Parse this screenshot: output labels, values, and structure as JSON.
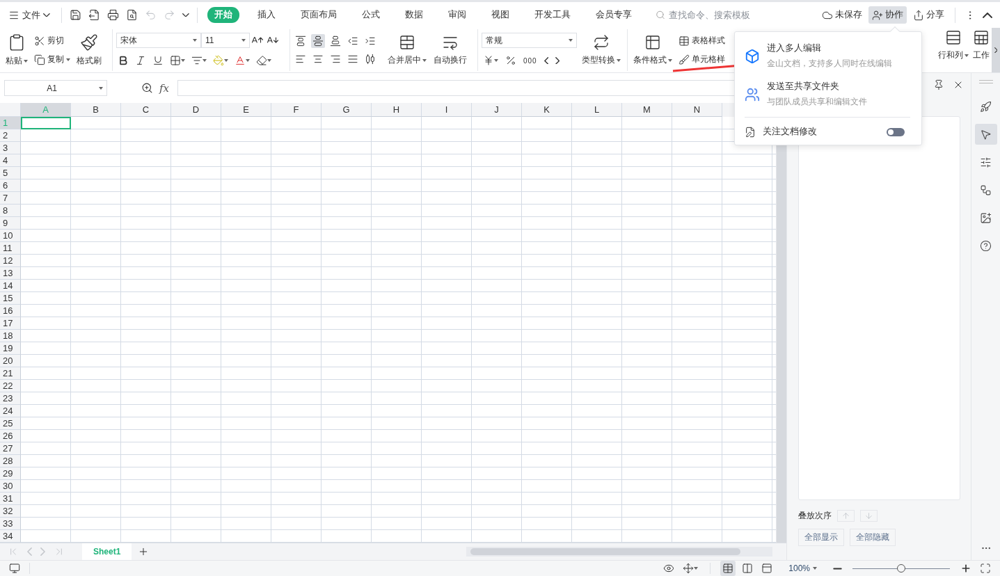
{
  "menu": {
    "label": "文件"
  },
  "quick_access": [
    {
      "kind": "save",
      "disabled": false
    },
    {
      "kind": "export",
      "disabled": false
    },
    {
      "kind": "print",
      "disabled": false
    },
    {
      "kind": "preview",
      "disabled": false
    },
    {
      "kind": "undo",
      "disabled": true
    },
    {
      "kind": "redo",
      "disabled": true
    },
    {
      "kind": "customize",
      "disabled": false
    }
  ],
  "tabs": [
    {
      "label": "开始",
      "selected": true
    },
    {
      "label": "插入",
      "selected": false
    },
    {
      "label": "页面布局",
      "selected": false
    },
    {
      "label": "公式",
      "selected": false
    },
    {
      "label": "数据",
      "selected": false
    },
    {
      "label": "审阅",
      "selected": false
    },
    {
      "label": "视图",
      "selected": false
    },
    {
      "label": "开发工具",
      "selected": false
    },
    {
      "label": "会员专享",
      "selected": false
    }
  ],
  "search": {
    "placeholder": "查找命令、搜索模板"
  },
  "header_actions": [
    {
      "kind": "unsaved",
      "label": "未保存",
      "selected": false
    },
    {
      "kind": "collab",
      "label": "协作",
      "selected": true
    },
    {
      "kind": "share",
      "label": "分享",
      "selected": false
    }
  ],
  "ribbon": {
    "clipboard": {
      "paste": "粘贴",
      "cut": "剪切",
      "copy": "复制",
      "format_painter": "格式刷"
    },
    "font": {
      "name": "宋体",
      "size": "11"
    },
    "align_buttons": [
      {
        "kind": "top",
        "selected": false
      },
      {
        "kind": "middle",
        "selected": true
      },
      {
        "kind": "bottom",
        "selected": false
      },
      {
        "kind": "outdent",
        "selected": false
      },
      {
        "kind": "indent",
        "selected": false
      },
      {
        "kind": "left",
        "selected": false
      },
      {
        "kind": "center",
        "selected": false
      },
      {
        "kind": "right",
        "selected": false
      },
      {
        "kind": "justify",
        "selected": false
      },
      {
        "kind": "distribute",
        "selected": false
      }
    ],
    "merge": "合并居中",
    "wrap": "自动换行",
    "number": {
      "format": "常规",
      "thousands": "000",
      "convert": "类型转换"
    },
    "styles": {
      "conditional": "条件格式",
      "table_style": "表格样式",
      "cell_style": "单元格样"
    },
    "rows_cols": "行和列",
    "worksheet": "工作"
  },
  "popup": {
    "items": [
      {
        "kind": "cloud_doc",
        "title": "进入多人编辑",
        "subtitle": "金山文档，支持多人同时在线编辑"
      },
      {
        "kind": "shared_folder",
        "title": "发送至共享文件夹",
        "subtitle": "与团队成员共享和编辑文件"
      }
    ],
    "toggle": {
      "label": "关注文档修改",
      "on": false
    }
  },
  "formula_bar": {
    "name_box": "A1",
    "fx": "fx"
  },
  "grid": {
    "columns": [
      {
        "label": "A",
        "selected": true
      },
      {
        "label": "B",
        "selected": false
      },
      {
        "label": "C",
        "selected": false
      },
      {
        "label": "D",
        "selected": false
      },
      {
        "label": "E",
        "selected": false
      },
      {
        "label": "F",
        "selected": false
      },
      {
        "label": "G",
        "selected": false
      },
      {
        "label": "H",
        "selected": false
      },
      {
        "label": "I",
        "selected": false
      },
      {
        "label": "J",
        "selected": false
      },
      {
        "label": "K",
        "selected": false
      },
      {
        "label": "L",
        "selected": false
      },
      {
        "label": "M",
        "selected": false
      },
      {
        "label": "N",
        "selected": false
      }
    ],
    "rows": [
      {
        "label": "1",
        "selected": true
      },
      {
        "label": "2",
        "selected": false
      },
      {
        "label": "3",
        "selected": false
      },
      {
        "label": "4",
        "selected": false
      },
      {
        "label": "5",
        "selected": false
      },
      {
        "label": "6",
        "selected": false
      },
      {
        "label": "7",
        "selected": false
      },
      {
        "label": "8",
        "selected": false
      },
      {
        "label": "9",
        "selected": false
      },
      {
        "label": "10",
        "selected": false
      },
      {
        "label": "11",
        "selected": false
      },
      {
        "label": "12",
        "selected": false
      },
      {
        "label": "13",
        "selected": false
      },
      {
        "label": "14",
        "selected": false
      },
      {
        "label": "15",
        "selected": false
      },
      {
        "label": "16",
        "selected": false
      },
      {
        "label": "17",
        "selected": false
      },
      {
        "label": "18",
        "selected": false
      },
      {
        "label": "19",
        "selected": false
      },
      {
        "label": "20",
        "selected": false
      },
      {
        "label": "21",
        "selected": false
      },
      {
        "label": "22",
        "selected": false
      },
      {
        "label": "23",
        "selected": false
      },
      {
        "label": "24",
        "selected": false
      },
      {
        "label": "25",
        "selected": false
      },
      {
        "label": "26",
        "selected": false
      },
      {
        "label": "27",
        "selected": false
      },
      {
        "label": "28",
        "selected": false
      },
      {
        "label": "29",
        "selected": false
      },
      {
        "label": "30",
        "selected": false
      },
      {
        "label": "31",
        "selected": false
      },
      {
        "label": "32",
        "selected": false
      },
      {
        "label": "33",
        "selected": false
      },
      {
        "label": "34",
        "selected": false
      }
    ]
  },
  "sheets": [
    {
      "label": "Sheet1",
      "selected": true
    }
  ],
  "side_panel": {
    "order_label": "叠放次序",
    "buttons": [
      "全部显示",
      "全部隐藏"
    ]
  },
  "side_tools": [
    {
      "kind": "rocket",
      "selected": false
    },
    {
      "kind": "pointer",
      "selected": true
    },
    {
      "kind": "sliders",
      "selected": false
    },
    {
      "kind": "flow",
      "selected": false
    },
    {
      "kind": "image",
      "selected": false
    },
    {
      "kind": "help",
      "selected": false
    }
  ],
  "status_bar": {
    "view_modes": [
      {
        "kind": "normal",
        "selected": true
      },
      {
        "kind": "page_break",
        "selected": false
      },
      {
        "kind": "reading",
        "selected": false
      }
    ],
    "zoom": "100%",
    "zoom_slider": {
      "level": 0.5
    }
  }
}
